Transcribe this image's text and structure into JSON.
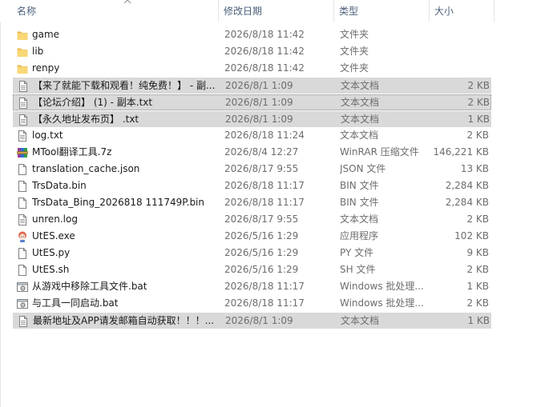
{
  "columns": {
    "name": "名称",
    "date": "修改日期",
    "type": "类型",
    "size": "大小"
  },
  "files": [
    {
      "name": "game",
      "date": "2026/8/18 11:42",
      "type": "文件夹",
      "size": "",
      "icon": "folder-icon",
      "selected": false
    },
    {
      "name": "lib",
      "date": "2026/8/18 11:42",
      "type": "文件夹",
      "size": "",
      "icon": "folder-icon",
      "selected": false
    },
    {
      "name": "renpy",
      "date": "2026/8/18 11:42",
      "type": "文件夹",
      "size": "",
      "icon": "folder-icon",
      "selected": false
    },
    {
      "name": "【来了就能下载和观看！纯免费！】 - 副...",
      "date": "2026/8/1 1:09",
      "type": "文本文档",
      "size": "2 KB",
      "icon": "text-file-icon",
      "selected": true
    },
    {
      "name": "【论坛介绍】 (1) - 副本.txt",
      "date": "2026/8/1 1:09",
      "type": "文本文档",
      "size": "2 KB",
      "icon": "text-file-icon",
      "selected": true,
      "focus": true
    },
    {
      "name": "【永久地址发布页】 .txt",
      "date": "2026/8/1 1:09",
      "type": "文本文档",
      "size": "1 KB",
      "icon": "text-file-icon",
      "selected": true
    },
    {
      "name": "log.txt",
      "date": "2026/8/18 11:24",
      "type": "文本文档",
      "size": "2 KB",
      "icon": "text-file-icon",
      "selected": false
    },
    {
      "name": "MTool翻译工具.7z",
      "date": "2026/8/4 12:27",
      "type": "WinRAR 压缩文件",
      "size": "146,221 KB",
      "icon": "winrar-archive-icon",
      "selected": false
    },
    {
      "name": "translation_cache.json",
      "date": "2026/8/17 9:55",
      "type": "JSON 文件",
      "size": "13 KB",
      "icon": "file-icon",
      "selected": false
    },
    {
      "name": "TrsData.bin",
      "date": "2026/8/18 11:17",
      "type": "BIN 文件",
      "size": "2,284 KB",
      "icon": "file-icon",
      "selected": false
    },
    {
      "name": "TrsData_Bing_2026818 111749P.bin",
      "date": "2026/8/18 11:17",
      "type": "BIN 文件",
      "size": "2,284 KB",
      "icon": "file-icon",
      "selected": false
    },
    {
      "name": "unren.log",
      "date": "2026/8/17 9:55",
      "type": "文本文档",
      "size": "2 KB",
      "icon": "text-file-icon",
      "selected": false
    },
    {
      "name": "UtES.exe",
      "date": "2026/5/16 1:29",
      "type": "应用程序",
      "size": "102 KB",
      "icon": "app-character-icon",
      "selected": false
    },
    {
      "name": "UtES.py",
      "date": "2026/5/16 1:29",
      "type": "PY 文件",
      "size": "9 KB",
      "icon": "file-icon",
      "selected": false
    },
    {
      "name": "UtES.sh",
      "date": "2026/5/16 1:29",
      "type": "SH 文件",
      "size": "2 KB",
      "icon": "file-icon",
      "selected": false
    },
    {
      "name": "从游戏中移除工具文件.bat",
      "date": "2026/8/18 11:17",
      "type": "Windows 批处理...",
      "size": "1 KB",
      "icon": "batch-file-icon",
      "selected": false
    },
    {
      "name": "与工具一同启动.bat",
      "date": "2026/8/18 11:17",
      "type": "Windows 批处理...",
      "size": "2 KB",
      "icon": "batch-file-icon",
      "selected": false
    },
    {
      "name": "最新地址及APP请发邮箱自动获取！！！...",
      "date": "2026/8/1 1:09",
      "type": "文本文档",
      "size": "1 KB",
      "icon": "text-file-icon",
      "selected": true
    }
  ],
  "colors": {
    "header_text": "#4c607a",
    "selection": "#d9d9d9",
    "folder": "#f8d775",
    "secondary_text": "#6d6d6d"
  }
}
